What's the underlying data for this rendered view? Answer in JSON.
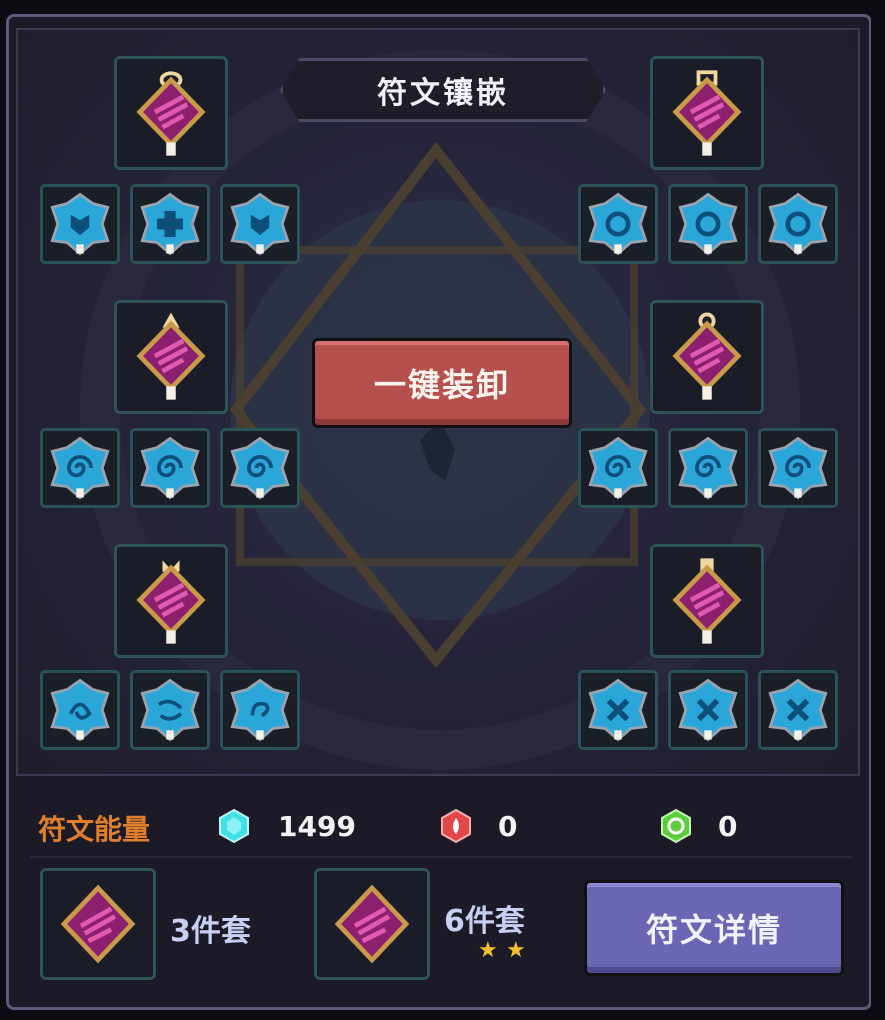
{
  "panel": {
    "title": "符文镶嵌",
    "unequip_all_label": "一键装卸"
  },
  "rune_groups": [
    {
      "position": "top-left",
      "main_icon": "magenta-rune-crystal",
      "sub_icons": [
        "blue-rune-shield",
        "blue-rune-cross",
        "blue-rune-shield"
      ]
    },
    {
      "position": "top-right",
      "main_icon": "magenta-rune-crystal",
      "sub_icons": [
        "blue-rune-circle",
        "blue-rune-circle",
        "blue-rune-circle"
      ]
    },
    {
      "position": "middle-left",
      "main_icon": "magenta-rune-crystal",
      "sub_icons": [
        "blue-rune-swirl",
        "blue-rune-swirl",
        "blue-rune-swirl"
      ]
    },
    {
      "position": "middle-right",
      "main_icon": "magenta-rune-crystal",
      "sub_icons": [
        "blue-rune-swirl",
        "blue-rune-swirl",
        "blue-rune-swirl"
      ]
    },
    {
      "position": "bottom-left",
      "main_icon": "magenta-rune-crystal",
      "sub_icons": [
        "blue-rune-swirl",
        "blue-rune-swirl",
        "blue-rune-swirl"
      ]
    },
    {
      "position": "bottom-right",
      "main_icon": "magenta-rune-crystal",
      "sub_icons": [
        "blue-rune-x",
        "blue-rune-x",
        "blue-rune-x"
      ]
    }
  ],
  "energy": {
    "label": "符文能量",
    "items": [
      {
        "icon": "cyan-gem-icon",
        "color": "#3fe0e6",
        "value": "1499"
      },
      {
        "icon": "red-fire-gem-icon",
        "color": "#e04848",
        "value": "0"
      },
      {
        "icon": "green-gem-icon",
        "color": "#5ccf3f",
        "value": "0"
      }
    ]
  },
  "sets": [
    {
      "label": "3件套",
      "stars": 0
    },
    {
      "label": "6件套",
      "stars": 2
    }
  ],
  "detail_button_label": "符文详情",
  "colors": {
    "rune_main": "#8c1f6e",
    "rune_border_gold": "#c99a4a",
    "rune_sub": "#2aa6d8",
    "slot_border": "#2f5458",
    "unequip_btn": "#b5504f",
    "detail_btn": "#6a66b3",
    "energy_label": "#e07f2b"
  }
}
